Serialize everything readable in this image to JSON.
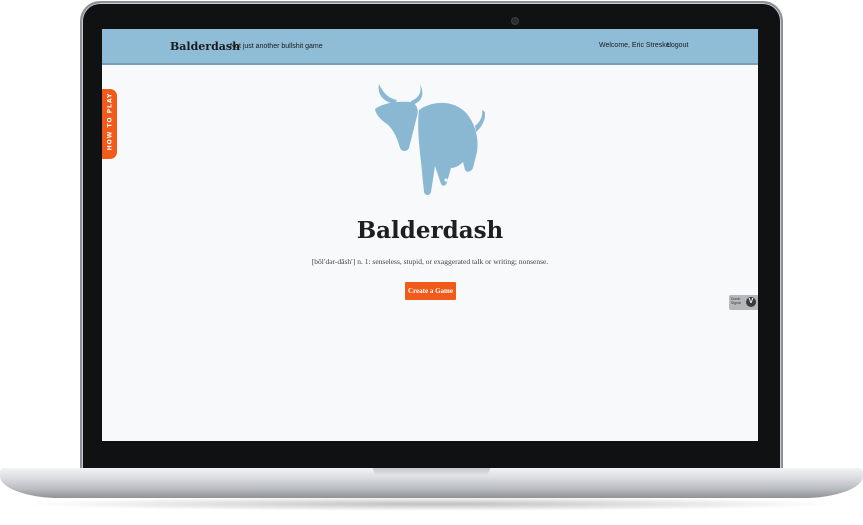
{
  "header": {
    "brand": "Balderdash",
    "tagline": "Not just another bullshit game",
    "welcome": "Welcome, Eric Streske!",
    "logout": "Logout"
  },
  "side_tab": {
    "label": "HOW TO PLAY"
  },
  "hero": {
    "logo_icon": "bull-logo-icon",
    "title": "Balderdash",
    "definition": "[bôl′dər-dăsh′] n. 1: senseless, stupid, or exaggerated talk or writing; nonsense.",
    "create_button": "Create a Game"
  },
  "widget": {
    "text": "Dumb Signal",
    "icon": "v-badge-icon"
  },
  "colors": {
    "header_bg": "#8fbcd6",
    "accent": "#f05a1a",
    "logo": "#8ab8d3",
    "page_bg": "#f7f9fb"
  }
}
